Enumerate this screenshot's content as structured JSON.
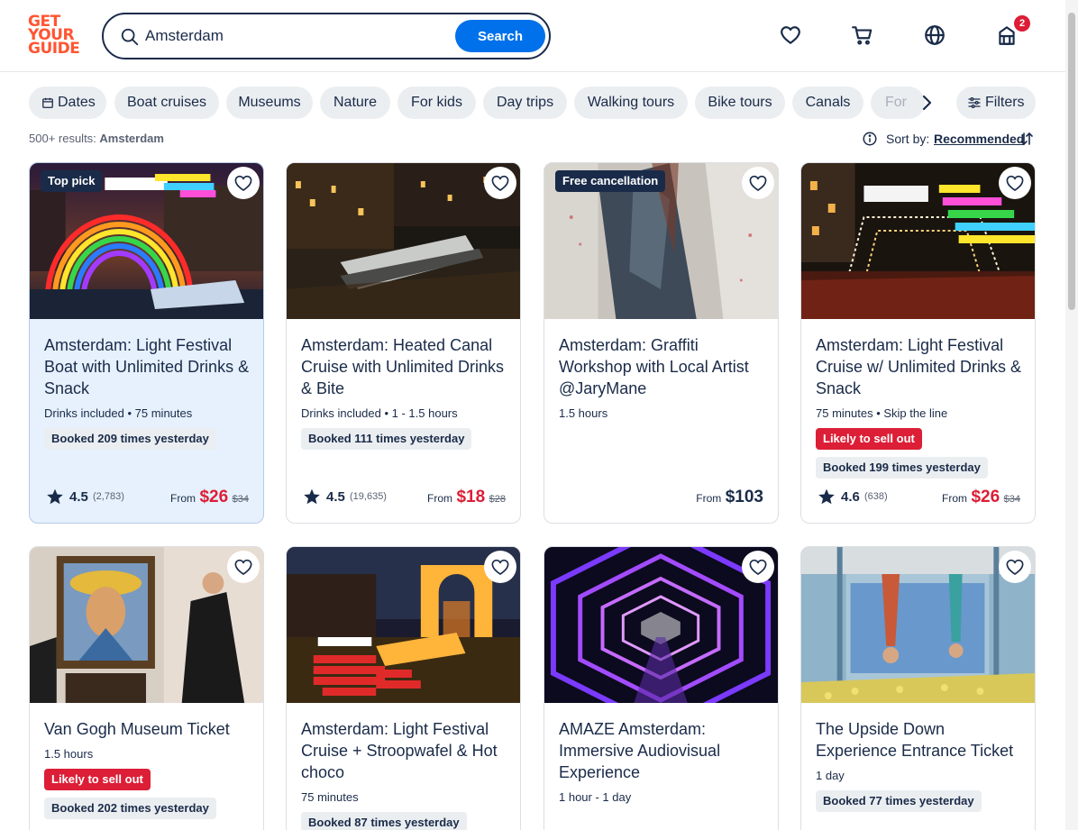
{
  "brand": {
    "logo_lines": [
      "GET",
      "YOUR",
      "GUIDE"
    ]
  },
  "search": {
    "value": "Amsterdam",
    "button_label": "Search"
  },
  "header": {
    "cart_badge": "2"
  },
  "chips": {
    "dates": "Dates",
    "items": [
      "Boat cruises",
      "Museums",
      "Nature",
      "For kids",
      "Day trips",
      "Walking tours",
      "Bike tours",
      "Canals",
      "For"
    ],
    "filters": "Filters"
  },
  "results": {
    "count": "500+ results:",
    "query": "Amsterdam"
  },
  "sort": {
    "label": "Sort by:",
    "value": "Recommended"
  },
  "cards": [
    {
      "tag": "Top pick",
      "title": "Amsterdam: Light Festival Boat with Unlimited Drinks & Snack",
      "meta": "Drinks included • 75 minutes",
      "booked": "Booked 209 times yesterday",
      "rating": "4.5",
      "reviews": "(2,783)",
      "from": "From",
      "price": "$26",
      "old_price": "$34"
    },
    {
      "title": "Amsterdam: Heated Canal Cruise with Unlimited Drinks & Bite",
      "meta": "Drinks included • 1 - 1.5 hours",
      "booked": "Booked 111 times yesterday",
      "rating": "4.5",
      "reviews": "(19,635)",
      "from": "From",
      "price": "$18",
      "old_price": "$28"
    },
    {
      "tag": "Free cancellation",
      "title": "Amsterdam: Graffiti Workshop with Local Artist @JaryMane",
      "meta": "1.5 hours",
      "from": "From",
      "price": "$103"
    },
    {
      "title": "Amsterdam: Light Festival Cruise w/ Unlimited Drinks & Snack",
      "meta": "75 minutes • Skip the line",
      "sell": "Likely to sell out",
      "booked": "Booked 199 times yesterday",
      "rating": "4.6",
      "reviews": "(638)",
      "from": "From",
      "price": "$26",
      "old_price": "$34"
    },
    {
      "title": "Van Gogh Museum Ticket",
      "meta": "1.5 hours",
      "sell": "Likely to sell out",
      "booked": "Booked 202 times yesterday"
    },
    {
      "title": "Amsterdam: Light Festival Cruise + Stroopwafel & Hot choco",
      "meta": "75 minutes",
      "booked": "Booked 87 times yesterday"
    },
    {
      "title": "AMAZE Amsterdam: Immersive Audiovisual Experience",
      "meta": "1 hour - 1 day"
    },
    {
      "title": "The Upside Down Experience Entrance Ticket",
      "meta": "1 day",
      "booked": "Booked 77 times yesterday"
    }
  ],
  "image_text": {
    "card1": [
      "amsterdam light festival",
      "UNLIMITED DRINKS",
      "GLÜHWEIN",
      "HOT CHOCOLATE",
      "WELCOME SNACK"
    ],
    "card4": [
      "amsterdam light festival",
      "BEST VIEWS",
      "WELCOME SNACK",
      "UNLIMITED DRINKS",
      "BEST LOCAL EXPERIENCE",
      "TOP RATED CRUISE CO"
    ],
    "card6": [
      "amsterdam light festival",
      "UNLIMITED DRINKS",
      "& HOT CHOCOLATE",
      "& SNACKS",
      "& STROOPWAFEL",
      "& GLÜHWEIN",
      "& HEATED BOAT"
    ]
  },
  "colors": {
    "brand": "#ff5533",
    "primary": "#0071eb",
    "price": "#dc1e36",
    "text": "#1a2b49"
  }
}
